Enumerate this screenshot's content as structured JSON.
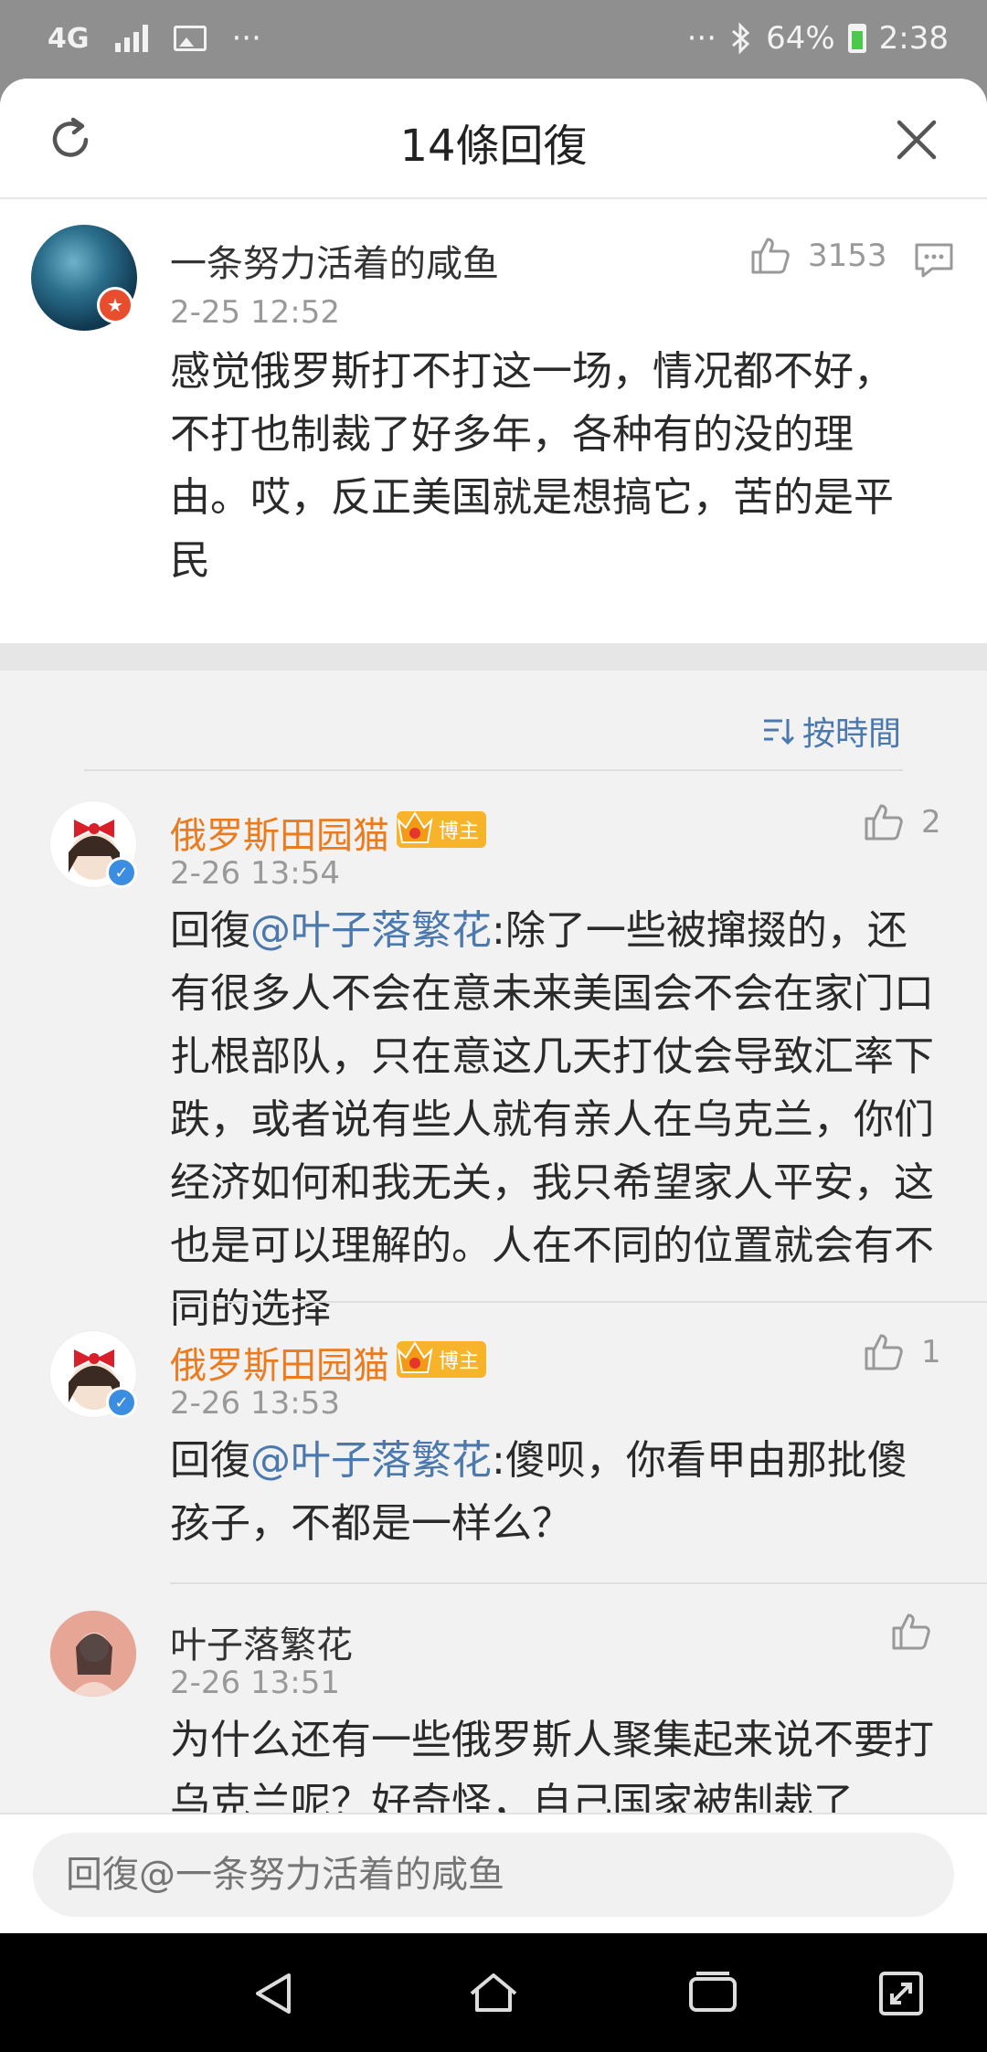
{
  "status_bar": {
    "network": "4G",
    "more": "···",
    "right_more": "···",
    "battery": "64%",
    "time": "2:38"
  },
  "sheet": {
    "title": "14條回復"
  },
  "main_comment": {
    "author": "一条努力活着的咸鱼",
    "time": "2-25 12:52",
    "likes": "3153",
    "text": "感觉俄罗斯打不打这一场，情况都不好，不打也制裁了好多年，各种有的没的理由。哎，反正美国就是想搞它，苦的是平民"
  },
  "sort": {
    "label": "按時間"
  },
  "replies": [
    {
      "author": "俄罗斯田园猫",
      "badge": "博主",
      "time": "2-26 13:54",
      "likes": "2",
      "prefix": "回復",
      "mention": "@叶子落繁花",
      "text": ":除了一些被撺掇的，还有很多人不会在意未来美国会不会在家门口扎根部队，只在意这几天打仗会导致汇率下跌，或者说有些人就有亲人在乌克兰，你们经济如何和我无关，我只希望家人平安，这也是可以理解的。人在不同的位置就会有不同的选择"
    },
    {
      "author": "俄罗斯田园猫",
      "badge": "博主",
      "time": "2-26 13:53",
      "likes": "1",
      "prefix": "回復",
      "mention": "@叶子落繁花",
      "text": ":傻呗，你看甲由那批傻孩子，不都是一样么？"
    },
    {
      "author": "叶子落繁花",
      "time": "2-26 13:51",
      "text": "为什么还有一些俄罗斯人聚集起来说不要打乌克兰呢？好奇怪，自己国家被制裁了"
    }
  ],
  "input": {
    "placeholder": "回復@一条努力活着的咸鱼"
  },
  "colors": {
    "accent_blue": "#4b79ad",
    "author_orange": "#ea7b1e",
    "vip_gold": "#f7b32a"
  }
}
